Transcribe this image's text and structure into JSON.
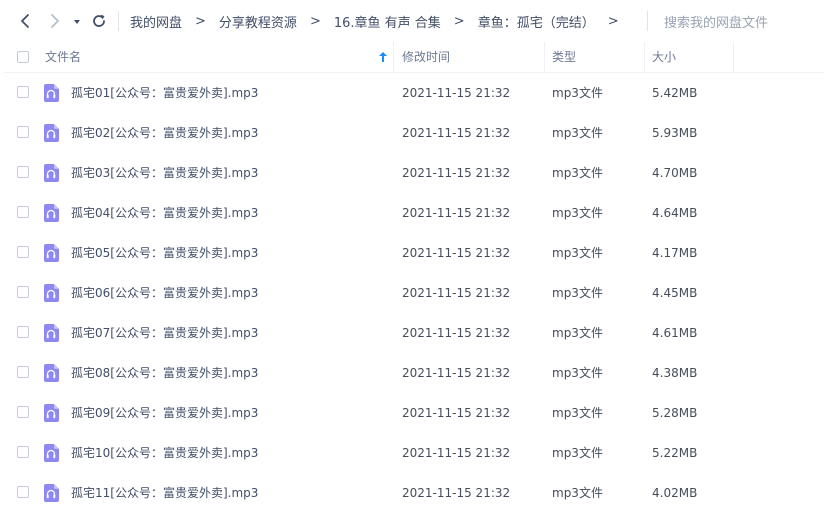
{
  "toolbar": {
    "back_icon": "chevron-left-icon",
    "forward_icon": "chevron-right-icon",
    "dropdown_icon": "caret-down-icon",
    "refresh_icon": "refresh-icon",
    "breadcrumbs": [
      "我的网盘",
      "分享教程资源",
      "16.章鱼 有声 合集",
      "章鱼：孤宅（完结）"
    ],
    "separator": ">",
    "search_placeholder": "搜索我的网盘文件"
  },
  "table": {
    "columns": {
      "name": "文件名",
      "modified": "修改时间",
      "type": "类型",
      "size": "大小"
    },
    "sort": {
      "column": "name",
      "direction": "asc",
      "icon": "arrow-up-icon",
      "color": "#1a8cff"
    },
    "file_icon": "audio-file-icon",
    "file_icon_color": "#8f88f2",
    "rows": [
      {
        "name": "孤宅01[公众号：富贵爱外卖].mp3",
        "modified": "2021-11-15 21:32",
        "type": "mp3文件",
        "size": "5.42MB"
      },
      {
        "name": "孤宅02[公众号：富贵爱外卖].mp3",
        "modified": "2021-11-15 21:32",
        "type": "mp3文件",
        "size": "5.93MB"
      },
      {
        "name": "孤宅03[公众号：富贵爱外卖].mp3",
        "modified": "2021-11-15 21:32",
        "type": "mp3文件",
        "size": "4.70MB"
      },
      {
        "name": "孤宅04[公众号：富贵爱外卖].mp3",
        "modified": "2021-11-15 21:32",
        "type": "mp3文件",
        "size": "4.64MB"
      },
      {
        "name": "孤宅05[公众号：富贵爱外卖].mp3",
        "modified": "2021-11-15 21:32",
        "type": "mp3文件",
        "size": "4.17MB"
      },
      {
        "name": "孤宅06[公众号：富贵爱外卖].mp3",
        "modified": "2021-11-15 21:32",
        "type": "mp3文件",
        "size": "4.45MB"
      },
      {
        "name": "孤宅07[公众号：富贵爱外卖].mp3",
        "modified": "2021-11-15 21:32",
        "type": "mp3文件",
        "size": "4.61MB"
      },
      {
        "name": "孤宅08[公众号：富贵爱外卖].mp3",
        "modified": "2021-11-15 21:32",
        "type": "mp3文件",
        "size": "4.38MB"
      },
      {
        "name": "孤宅09[公众号：富贵爱外卖].mp3",
        "modified": "2021-11-15 21:32",
        "type": "mp3文件",
        "size": "5.28MB"
      },
      {
        "name": "孤宅10[公众号：富贵爱外卖].mp3",
        "modified": "2021-11-15 21:32",
        "type": "mp3文件",
        "size": "5.22MB"
      },
      {
        "name": "孤宅11[公众号：富贵爱外卖].mp3",
        "modified": "2021-11-15 21:32",
        "type": "mp3文件",
        "size": "4.02MB"
      }
    ]
  }
}
